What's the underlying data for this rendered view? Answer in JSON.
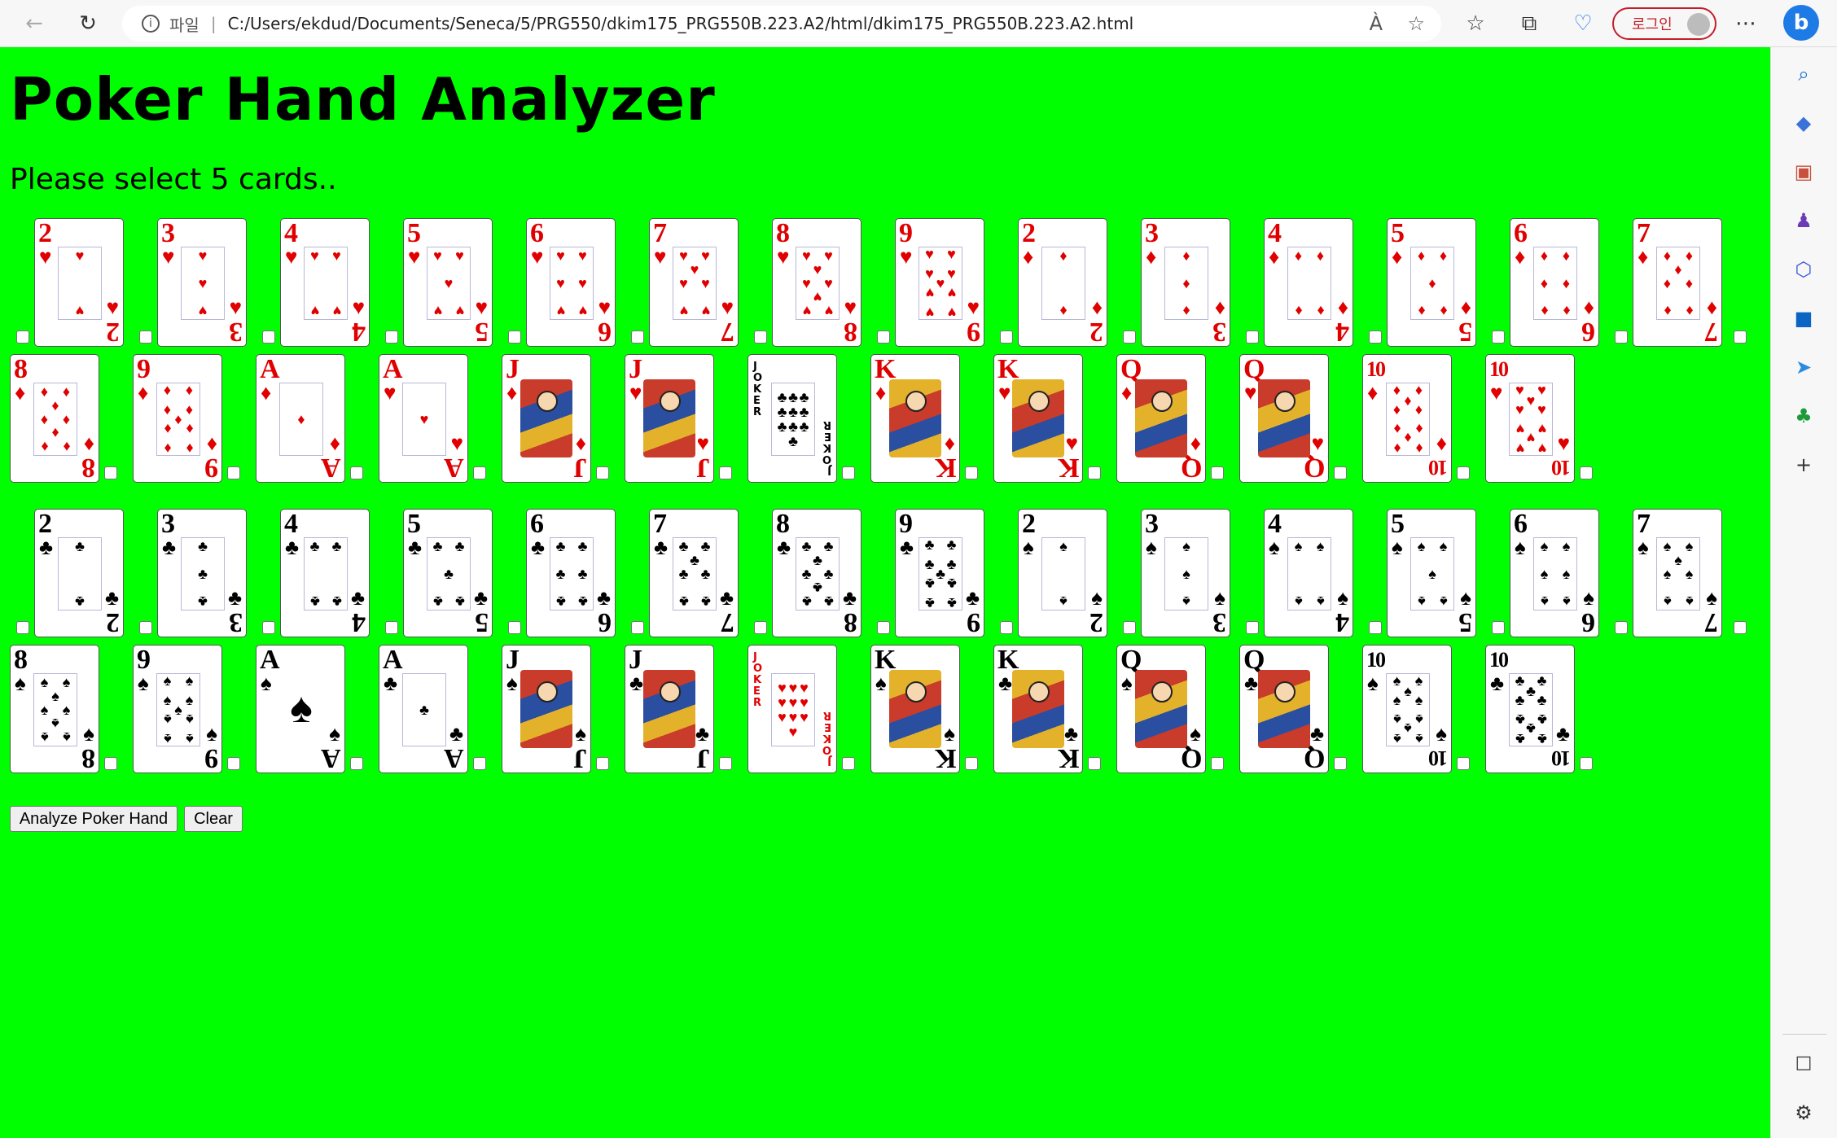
{
  "browser": {
    "scheme_label": "파일",
    "url": "C:/Users/ekdud/Documents/Seneca/5/PRG550/dkim175_PRG550B.223.A2/html/dkim175_PRG550B.223.A2.html",
    "login_label": "로그인"
  },
  "page": {
    "title": "Poker Hand Analyzer",
    "instructions": "Please select 5 cards..",
    "analyze_label": "Analyze Poker Hand",
    "clear_label": "Clear",
    "background_color": "#00ff00"
  },
  "card_rows": [
    {
      "layout": "indented",
      "cards": [
        {
          "rank": "2",
          "suit": "hearts"
        },
        {
          "rank": "3",
          "suit": "hearts"
        },
        {
          "rank": "4",
          "suit": "hearts"
        },
        {
          "rank": "5",
          "suit": "hearts"
        },
        {
          "rank": "6",
          "suit": "hearts"
        },
        {
          "rank": "7",
          "suit": "hearts"
        },
        {
          "rank": "8",
          "suit": "hearts"
        },
        {
          "rank": "9",
          "suit": "hearts"
        },
        {
          "rank": "2",
          "suit": "diamonds"
        },
        {
          "rank": "3",
          "suit": "diamonds"
        },
        {
          "rank": "4",
          "suit": "diamonds"
        },
        {
          "rank": "5",
          "suit": "diamonds"
        },
        {
          "rank": "6",
          "suit": "diamonds"
        },
        {
          "rank": "7",
          "suit": "diamonds"
        }
      ]
    },
    {
      "layout": "flush",
      "cards": [
        {
          "rank": "8",
          "suit": "diamonds"
        },
        {
          "rank": "9",
          "suit": "diamonds"
        },
        {
          "rank": "A",
          "suit": "diamonds"
        },
        {
          "rank": "A",
          "suit": "hearts"
        },
        {
          "rank": "J",
          "suit": "diamonds"
        },
        {
          "rank": "J",
          "suit": "hearts"
        },
        {
          "rank": "JOKER",
          "suit": "joker-black"
        },
        {
          "rank": "K",
          "suit": "diamonds"
        },
        {
          "rank": "K",
          "suit": "hearts"
        },
        {
          "rank": "Q",
          "suit": "diamonds"
        },
        {
          "rank": "Q",
          "suit": "hearts"
        },
        {
          "rank": "10",
          "suit": "diamonds"
        },
        {
          "rank": "10",
          "suit": "hearts"
        }
      ]
    },
    {
      "layout": "indented",
      "cards": [
        {
          "rank": "2",
          "suit": "clubs"
        },
        {
          "rank": "3",
          "suit": "clubs"
        },
        {
          "rank": "4",
          "suit": "clubs"
        },
        {
          "rank": "5",
          "suit": "clubs"
        },
        {
          "rank": "6",
          "suit": "clubs"
        },
        {
          "rank": "7",
          "suit": "clubs"
        },
        {
          "rank": "8",
          "suit": "clubs"
        },
        {
          "rank": "9",
          "suit": "clubs"
        },
        {
          "rank": "2",
          "suit": "spades"
        },
        {
          "rank": "3",
          "suit": "spades"
        },
        {
          "rank": "4",
          "suit": "spades"
        },
        {
          "rank": "5",
          "suit": "spades"
        },
        {
          "rank": "6",
          "suit": "spades"
        },
        {
          "rank": "7",
          "suit": "spades"
        }
      ]
    },
    {
      "layout": "flush",
      "cards": [
        {
          "rank": "8",
          "suit": "spades"
        },
        {
          "rank": "9",
          "suit": "spades"
        },
        {
          "rank": "A",
          "suit": "spades"
        },
        {
          "rank": "A",
          "suit": "clubs"
        },
        {
          "rank": "J",
          "suit": "spades"
        },
        {
          "rank": "J",
          "suit": "clubs"
        },
        {
          "rank": "JOKER",
          "suit": "joker-red"
        },
        {
          "rank": "K",
          "suit": "spades"
        },
        {
          "rank": "K",
          "suit": "clubs"
        },
        {
          "rank": "Q",
          "suit": "spades"
        },
        {
          "rank": "Q",
          "suit": "clubs"
        },
        {
          "rank": "10",
          "suit": "spades"
        },
        {
          "rank": "10",
          "suit": "clubs"
        }
      ]
    }
  ],
  "icons": {
    "back": "back-arrow-icon",
    "refresh": "refresh-icon",
    "info": "info-icon",
    "read_aloud": "read-aloud-icon",
    "favorite_add": "add-favorite-icon",
    "favorites": "favorites-icon",
    "collections": "collections-icon",
    "performance": "browser-essentials-icon",
    "more": "more-icon",
    "bing": "bing-copilot-icon"
  }
}
